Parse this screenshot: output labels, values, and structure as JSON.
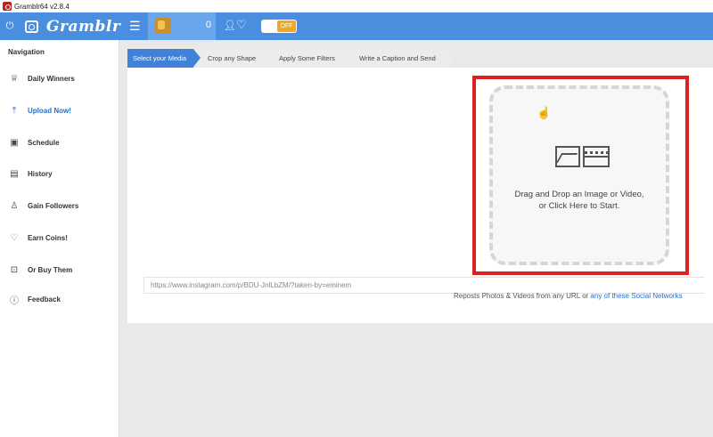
{
  "window": {
    "title": "Gramblr64 v2.8.4"
  },
  "topbar": {
    "brand": "Gramblr",
    "coins": "0",
    "toggle_label": "OFF",
    "icons": [
      "power-icon",
      "camera-logo-icon",
      "menu-icon",
      "coin-stack-icon",
      "user-icon",
      "heart-icon"
    ]
  },
  "sidebar": {
    "title": "Navigation",
    "items": [
      {
        "label": "Daily Winners",
        "icon": "trophy-icon"
      },
      {
        "label": "Upload Now!",
        "icon": "upload-icon"
      },
      {
        "label": "Schedule",
        "icon": "calendar-icon"
      },
      {
        "label": "History",
        "icon": "history-icon"
      },
      {
        "label": "Gain Followers",
        "icon": "user-icon"
      },
      {
        "label": "Earn Coins!",
        "icon": "heart-icon"
      },
      {
        "label": "Or Buy Them",
        "icon": "cart-icon"
      },
      {
        "label": "Feedback",
        "icon": "help-icon"
      }
    ],
    "active_item": "Upload Now!"
  },
  "steps": [
    {
      "label": "Select your Media",
      "active": true
    },
    {
      "label": "Crop any Shape",
      "active": false
    },
    {
      "label": "Apply Some Filters",
      "active": false
    },
    {
      "label": "Write a Caption and Send",
      "active": false
    }
  ],
  "dropzone": {
    "line1": "Drag and Drop an Image or Video,",
    "line2": "or Click Here to Start."
  },
  "url_input": {
    "placeholder": "https://www.instagram.com/p/BDU-JnlLbZM/?taken-by=eminem",
    "value": ""
  },
  "repost_note": {
    "text": "Reposts Photos & Videos from any URL or",
    "link": "any of these Social Networks"
  },
  "colors": {
    "topbar": "#4a8fdf",
    "coinbox": "#6aa6ec",
    "active_step": "#3f82d8",
    "highlight_border": "#e02020",
    "toggle_off": "#f0a72a",
    "active_nav": "#2a6fc9"
  }
}
